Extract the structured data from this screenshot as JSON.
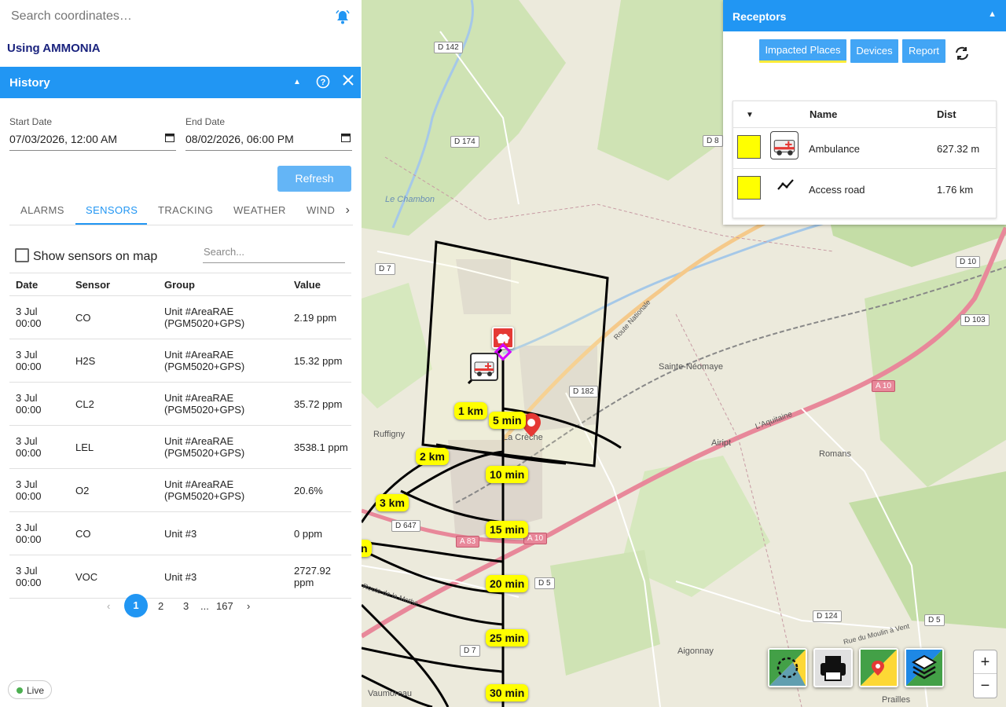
{
  "search": {
    "placeholder": "Search coordinates…"
  },
  "using_label": "Using AMMONIA",
  "history": {
    "title": "History",
    "start_label": "Start Date",
    "start_value": "07/03/2026, 12:00 AM",
    "end_label": "End Date",
    "end_value": "08/02/2026, 06:00 PM",
    "refresh_label": "Refresh",
    "tabs": [
      "ALARMS",
      "SENSORS",
      "TRACKING",
      "WEATHER",
      "WIND"
    ],
    "active_tab": "SENSORS",
    "show_sensors_label": "Show sensors on map",
    "search_placeholder": "Search...",
    "columns": [
      "Date",
      "Sensor",
      "Group",
      "Value"
    ],
    "rows": [
      {
        "date": [
          "3 Jul",
          "00:00"
        ],
        "sensor": "CO",
        "group": [
          "Unit #AreaRAE",
          "(PGM5020+GPS)"
        ],
        "value": [
          "2.19 ppm"
        ]
      },
      {
        "date": [
          "3 Jul",
          "00:00"
        ],
        "sensor": "H2S",
        "group": [
          "Unit #AreaRAE",
          "(PGM5020+GPS)"
        ],
        "value": [
          "15.32 ppm"
        ]
      },
      {
        "date": [
          "3 Jul",
          "00:00"
        ],
        "sensor": "CL2",
        "group": [
          "Unit #AreaRAE",
          "(PGM5020+GPS)"
        ],
        "value": [
          "35.72 ppm"
        ]
      },
      {
        "date": [
          "3 Jul",
          "00:00"
        ],
        "sensor": "LEL",
        "group": [
          "Unit #AreaRAE",
          "(PGM5020+GPS)"
        ],
        "value": [
          "3538.1 ppm"
        ]
      },
      {
        "date": [
          "3 Jul",
          "00:00"
        ],
        "sensor": "O2",
        "group": [
          "Unit #AreaRAE",
          "(PGM5020+GPS)"
        ],
        "value": [
          "20.6%"
        ]
      },
      {
        "date": [
          "3 Jul",
          "00:00"
        ],
        "sensor": "CO",
        "group": [
          "Unit #3"
        ],
        "value": [
          "0 ppm"
        ]
      },
      {
        "date": [
          "3 Jul",
          "00:00"
        ],
        "sensor": "VOC",
        "group": [
          "Unit #3"
        ],
        "value": [
          "2727.92",
          "ppm"
        ]
      }
    ],
    "pagination": {
      "current": "1",
      "pages": [
        "2",
        "3"
      ],
      "ellipsis": "...",
      "last": "167"
    }
  },
  "live_label": "Live",
  "receptors": {
    "title": "Receptors",
    "buttons": [
      "Impacted Places",
      "Devices",
      "Report"
    ],
    "columns": {
      "sort": "▼",
      "name": "Name",
      "dist": "Dist"
    },
    "rows": [
      {
        "name": "Ambulance",
        "dist": "627.32 m",
        "icon": "ambulance-icon"
      },
      {
        "name": "Access road",
        "dist": "1.76 km",
        "icon": "road-line-icon"
      }
    ]
  },
  "map": {
    "places": [
      "Sainte-Néomaye",
      "Ruffigny",
      "La Crèche",
      "Aiript",
      "Romans",
      "Aigonnay",
      "Vaumoreau",
      "Prailles",
      "Le Chambon"
    ],
    "roads": [
      "D 142",
      "D 174",
      "D 8",
      "D 7",
      "D 182",
      "D 10",
      "D 103",
      "A 10",
      "D 647",
      "A 83",
      "A 10",
      "D 5",
      "D 124",
      "D 5",
      "D 7"
    ],
    "road_names": [
      "L'Aquitaine",
      "Route Nationale",
      "Route de la Mothe",
      "Rue du Moulin à Vent"
    ],
    "distance_rings": [
      "1 km",
      "2 km",
      "3 km",
      "n"
    ],
    "time_rings": [
      "5 min",
      "10 min",
      "15 min",
      "20 min",
      "25 min",
      "30 min"
    ],
    "zoom_in": "+",
    "zoom_out": "−",
    "colors": {
      "iso_label": "#ffff00",
      "water": "#a5c8e8",
      "forest": "#b8d8a0",
      "motorway": "#e8889a",
      "primary": "#f5c98a"
    }
  }
}
